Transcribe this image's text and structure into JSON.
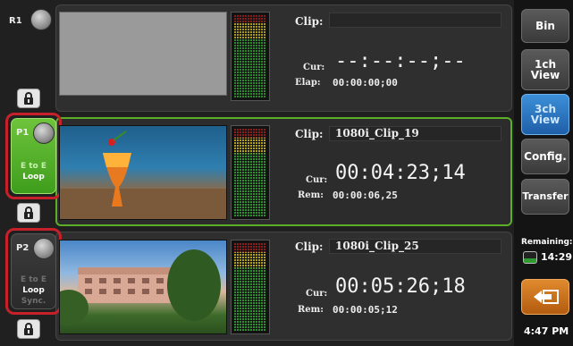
{
  "channels": [
    {
      "id": "R1",
      "modes": [],
      "clip_label": "Clip:",
      "clip_name": "",
      "cur_label": "Cur:",
      "cur_tc": "--:--:--;--",
      "sub_label": "Elap:",
      "sub_tc": "00:00:00;00"
    },
    {
      "id": "P1",
      "modes": [
        "E to E",
        "Loop"
      ],
      "clip_label": "Clip:",
      "clip_name": "1080i_Clip_19",
      "cur_label": "Cur:",
      "cur_tc": "00:04:23;14",
      "sub_label": "Rem:",
      "sub_tc": "00:00:06,25"
    },
    {
      "id": "P2",
      "modes": [
        "E to E",
        "Loop",
        "Sync."
      ],
      "clip_label": "Clip:",
      "clip_name": "1080i_Clip_25",
      "cur_label": "Cur:",
      "cur_tc": "00:05:26;18",
      "sub_label": "Rem:",
      "sub_tc": "00:00:05;12"
    }
  ],
  "sidebar": {
    "bin": "Bin",
    "view1_line1": "1ch",
    "view1_line2": "View",
    "view3_line1": "3ch",
    "view3_line2": "View",
    "config": "Config.",
    "transfer": "Transfer",
    "remaining_label": "Remaining:",
    "remaining_value": "14:29",
    "clock": "4:47 PM"
  },
  "colors": {
    "active_green": "#5dae27",
    "highlight_red": "#c8202a",
    "blue_button": "#2f78c4",
    "orange_button": "#d07a20"
  },
  "icons": [
    "lock-icon",
    "knob-icon",
    "storage-icon",
    "back-arrow-icon"
  ]
}
